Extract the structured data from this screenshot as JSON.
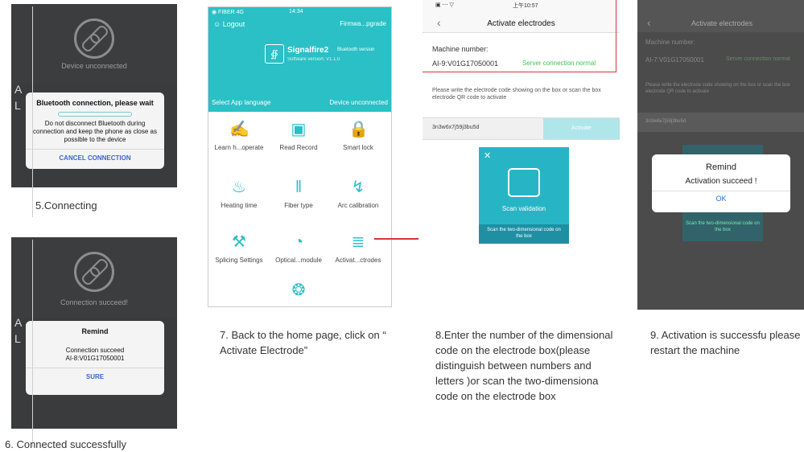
{
  "step5": {
    "status": "Device unconnected",
    "side_letters": [
      "A",
      "L"
    ],
    "dialog_title": "Bluetooth connection, please wait",
    "dialog_text": "Do not disconnect Bluetooth during connection and keep the phone as close as possible to the device",
    "dialog_action": "CANCEL CONNECTION",
    "caption": "5.Connecting"
  },
  "step6": {
    "status": "Connection succeed!",
    "side_letters": [
      "A",
      "L"
    ],
    "dialog_title": "Remind",
    "dialog_text": "Connection succeed",
    "dialog_code": "AI-8:V01G17050001",
    "dialog_action": "SURE",
    "caption": "6. Connected successfully"
  },
  "step7": {
    "status_left": "◉ FIBER 4G",
    "status_time": "14:34",
    "logout": "Logout",
    "firmware": "Firmwa...pgrade",
    "device_name": "Signalfire2",
    "device_sub": "Bluetooth version",
    "software": "Software version: V1.1.0",
    "select_lang": "Select App language",
    "device_state": "Device unconnected",
    "menu": [
      {
        "label": "Learn h...operate",
        "icon": "✍"
      },
      {
        "label": "Read Record",
        "icon": "▣"
      },
      {
        "label": "Smart lock",
        "icon": "ὑ2"
      },
      {
        "label": "Heating time",
        "icon": "♨"
      },
      {
        "label": "Fiber type",
        "icon": "‖"
      },
      {
        "label": "Arc calibration",
        "icon": "↯"
      },
      {
        "label": "Splicing Settings",
        "icon": "⚒"
      },
      {
        "label": "Optical...module",
        "icon": "◔"
      },
      {
        "label": "Activat...ctrodes",
        "icon": "≣"
      }
    ],
    "bottom_icon": "❂",
    "caption": "7. Back to the home page, click on “ Activate Electrode”"
  },
  "step8": {
    "status_time": "上午10:57",
    "nav_title": "Activate electrodes",
    "machine_label": "Machine number:",
    "machine_number": "AI-9:V01G17050001",
    "server_status": "Server connection normal",
    "instructions": "Please write the electrode code showing on the box or scan the box electrode QR code to activate",
    "code_value": "3n3w6x7j59j3bu5d",
    "activate_button": "Activate",
    "scan_title": "Scan validation",
    "scan_sub": "Scan the two-dimensional code on the box",
    "caption": "8.Enter the number of the dimensional code on the electrode box(please distinguish between numbers and letters )or scan the two-dimensiona code on the electrode box"
  },
  "step9": {
    "nav_title": "Activate electrodes",
    "machine_label": "Machine number:",
    "machine_number": "AI-7:V01G17050001",
    "server_status": "Server connection normal",
    "instructions": "Please write the electrode code showing on the box or scan the box electrode QR code to activate",
    "code_value": "3n3w6x7j59j3bu5d",
    "scan_sub": "Scan the two-dimensional code on the box",
    "dialog_title": "Remind",
    "dialog_text": "Activation succeed !",
    "dialog_ok": "OK",
    "caption": "9. Activation is successfu please restart the machine"
  },
  "colors": {
    "teal": "#2ac0c5",
    "red_callout": "#d9343c",
    "green_status": "#3ec255"
  }
}
